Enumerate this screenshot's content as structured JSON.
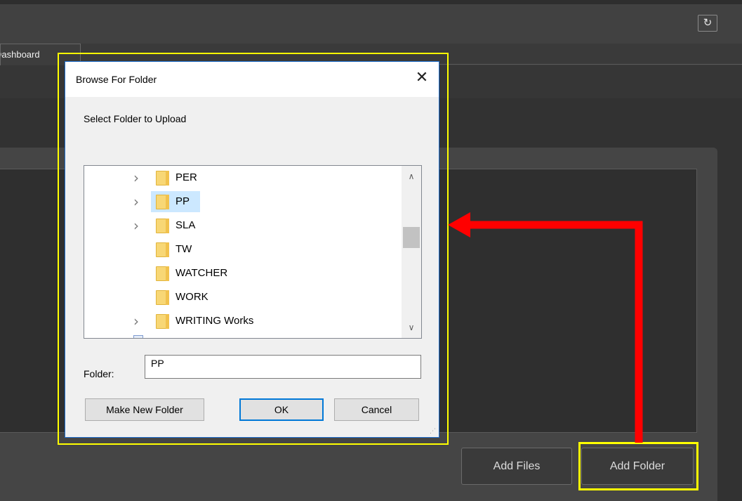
{
  "app": {
    "tab_label": "Dashboard",
    "refresh_icon": "refresh-icon",
    "add_files_label": "Add Files",
    "add_folder_label": "Add Folder"
  },
  "dialog": {
    "title": "Browse For Folder",
    "description": "Select Folder to Upload",
    "tree_items": [
      {
        "label": "PER",
        "expandable": true,
        "selected": false
      },
      {
        "label": "PP",
        "expandable": true,
        "selected": true
      },
      {
        "label": "SLA",
        "expandable": true,
        "selected": false
      },
      {
        "label": "TW",
        "expandable": false,
        "selected": false
      },
      {
        "label": "WATCHER",
        "expandable": false,
        "selected": false
      },
      {
        "label": "WORK",
        "expandable": false,
        "selected": false
      },
      {
        "label": "WRITING Works",
        "expandable": true,
        "selected": false
      }
    ],
    "folder_field_label": "Folder:",
    "folder_field_value": "PP",
    "make_new_folder_label": "Make New Folder",
    "ok_label": "OK",
    "cancel_label": "Cancel"
  },
  "annotation": {
    "highlight_color": "#ffff00",
    "arrow_color": "#ff0000"
  }
}
